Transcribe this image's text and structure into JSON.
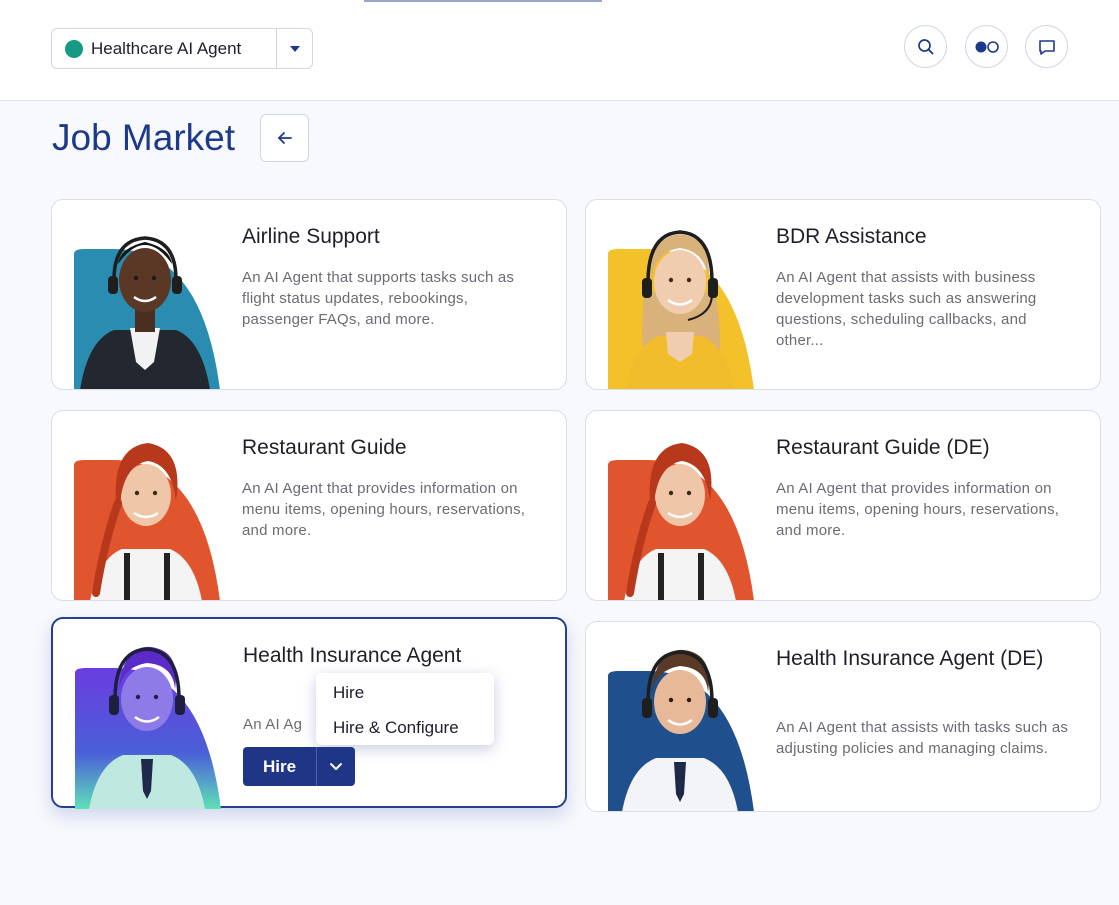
{
  "header": {
    "agent_selector": {
      "name": "Healthcare AI Agent",
      "status_color": "#169a85"
    },
    "icons": [
      "search-icon",
      "toggle-icon",
      "chat-icon"
    ]
  },
  "page": {
    "title": "Job Market"
  },
  "cards": [
    {
      "title": "Airline Support",
      "description": "An AI Agent that supports tasks such as flight status updates, rebookings, passenger FAQs, and more."
    },
    {
      "title": "BDR Assistance",
      "description": "An AI Agent that assists with business development tasks such as answering questions, scheduling callbacks, and other..."
    },
    {
      "title": "Restaurant Guide",
      "description": "An AI Agent that provides information on menu items, opening hours, reservations, and more."
    },
    {
      "title": "Restaurant Guide (DE)",
      "description": "An AI Agent that provides information on menu items, opening hours, reservations, and more."
    },
    {
      "title": "Health Insurance Agent",
      "description": "An AI Ag",
      "hire_label": "Hire"
    },
    {
      "title": "Health Insurance Agent (DE)",
      "description": "An AI Agent that assists with tasks such as adjusting policies and managing claims."
    }
  ],
  "hire_menu": {
    "items": [
      "Hire",
      "Hire & Configure"
    ]
  },
  "colors": {
    "accent": "#1d3a8a",
    "button": "#1f3687",
    "background": "#f8f9fc"
  }
}
